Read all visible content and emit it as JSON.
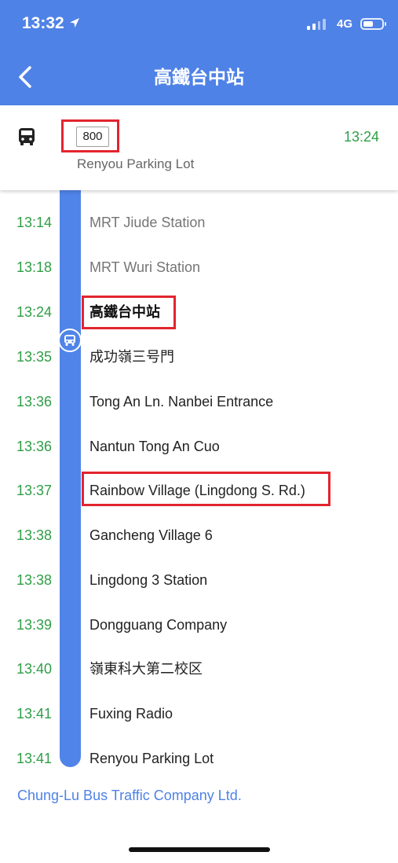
{
  "status_bar": {
    "time": "13:32",
    "network": "4G"
  },
  "header": {
    "title": "高鐵台中站"
  },
  "route": {
    "number": "800",
    "destination": "Renyou Parking Lot",
    "time": "13:24"
  },
  "stops": [
    {
      "time": "13:14",
      "name": "MRT Jiude Station"
    },
    {
      "time": "13:18",
      "name": "MRT Wuri Station"
    },
    {
      "time": "13:24",
      "name": "高鐵台中站"
    },
    {
      "time": "13:35",
      "name": "成功嶺三号門"
    },
    {
      "time": "13:36",
      "name": "Tong An Ln. Nanbei Entrance"
    },
    {
      "time": "13:36",
      "name": "Nantun Tong An Cuo"
    },
    {
      "time": "13:37",
      "name": "Rainbow Village (Lingdong S. Rd.)"
    },
    {
      "time": "13:38",
      "name": "Gancheng Village 6"
    },
    {
      "time": "13:38",
      "name": "Lingdong 3 Station"
    },
    {
      "time": "13:39",
      "name": "Dongguang Company"
    },
    {
      "time": "13:40",
      "name": "嶺東科大第二校区"
    },
    {
      "time": "13:41",
      "name": "Fuxing Radio"
    },
    {
      "time": "13:41",
      "name": "Renyou Parking Lot"
    }
  ],
  "operator": "Chung-Lu Bus Traffic Company Ltd.",
  "colors": {
    "header": "#4F82E6",
    "time_green": "#2E9E46",
    "highlight": "#E2252F",
    "timeline": "#5084E8"
  }
}
